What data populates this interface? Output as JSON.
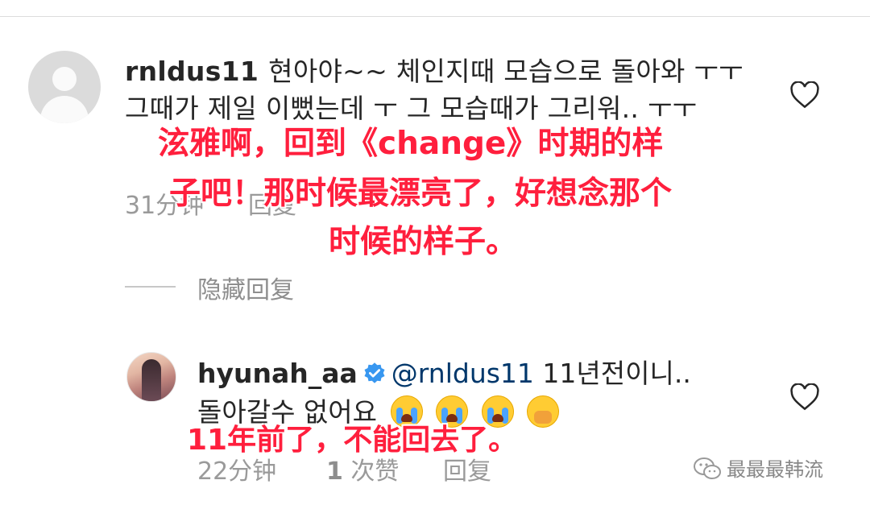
{
  "comment1": {
    "username": "rnldus11",
    "text": "현아야~~ 체인지때 모습으로 돌아와 ㅜㅜ 그때가 제일 이뻤는데 ㅜ 그 모습때가 그리워.. ㅜㅜ",
    "time": "31分钟",
    "reply_label": "回复",
    "caption_lines": [
      "泫雅啊，回到《change》时期的样",
      "子吧！那时候最漂亮了，好想念那个",
      "时候的样子。"
    ]
  },
  "hide_replies_label": "隐藏回复",
  "comment2": {
    "username": "hyunah_aa",
    "mention": "@rnldus11",
    "text_line1": "11년전이니..",
    "text_line2": "돌아갈수 없어요",
    "time": "22分钟",
    "likes_count": "1",
    "likes_label": "次赞",
    "reply_label": "回复",
    "caption": "11年前了，不能回去了。"
  },
  "watermark": "最最最韩流",
  "icons": {
    "like": "heart-outline-icon",
    "verified": "verified-badge-icon",
    "wechat": "wechat-icon"
  },
  "colors": {
    "caption": "#ff1f3d",
    "verified": "#3897f0",
    "mention": "#00376b"
  }
}
